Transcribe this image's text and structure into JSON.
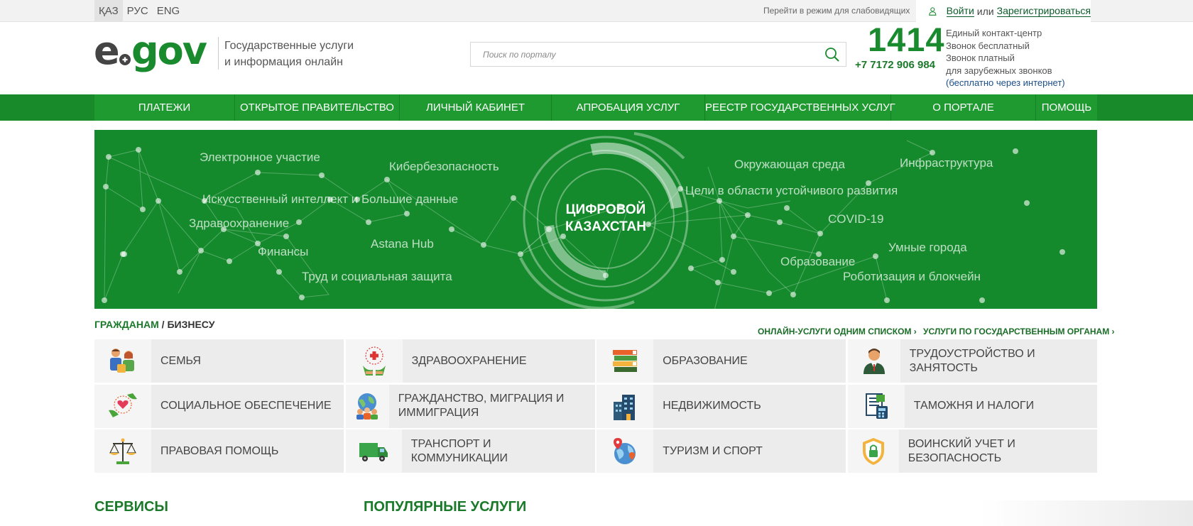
{
  "topbar": {
    "languages": [
      "ҚАЗ",
      "РУС",
      "ENG"
    ],
    "low_vision_label": "Перейти в режим для слабовидящих",
    "login_label": "Войти",
    "or_label": "или",
    "register_label": "Зарегистрироваться"
  },
  "header": {
    "tagline_line1": "Государственные услуги",
    "tagline_line2": "и информация онлайн",
    "search_placeholder": "Поиск по порталу",
    "phone_short": "1414",
    "phone_full": "+7 7172 906 984",
    "contact_lines": [
      "Единый контакт-центр",
      "Звонок бесплатный",
      "Звонок платный",
      "для зарубежных звонков"
    ],
    "contact_link": "(бесплатно через интернет)"
  },
  "nav": {
    "items": [
      "ПЛАТЕЖИ",
      "ОТКРЫТОЕ ПРАВИТЕЛЬСТВО",
      "ЛИЧНЫЙ КАБИНЕТ",
      "АПРОБАЦИЯ УСЛУГ",
      "РЕЕСТР ГОСУДАРСТВЕННЫХ УСЛУГ",
      "О ПОРТАЛЕ",
      "ПОМОЩЬ"
    ]
  },
  "banner": {
    "title_line1": "ЦИФРОВОЙ",
    "title_line2": "КАЗАХСТАН",
    "words": [
      "Электронное участие",
      "Кибербезопасность",
      "Искусственный интеллект и Большие данные",
      "Здравоохранение",
      "Финансы",
      "Astana Hub",
      "Труд и социальная защита",
      "Окружающая среда",
      "Инфраструктура",
      "Цели в области устойчивого развития",
      "COVID-19",
      "Умные города",
      "Образование",
      "Роботизация и блокчейн"
    ]
  },
  "sections": {
    "tab_citizens": "ГРАЖДАНАМ",
    "tab_sep": "/",
    "tab_business": "БИЗНЕСУ",
    "link_all_online": "ОНЛАЙН-УСЛУГИ ОДНИМ СПИСКОМ",
    "link_by_agency": "УСЛУГИ ПО ГОСУДАРСТВЕННЫМ ОРГАНАМ",
    "categories": [
      {
        "label": "СЕМЬЯ",
        "icon": "family-icon"
      },
      {
        "label": "ЗДРАВООХРАНЕНИЕ",
        "icon": "healthcare-icon"
      },
      {
        "label": "ОБРАЗОВАНИЕ",
        "icon": "books-icon"
      },
      {
        "label": "ТРУДОУСТРОЙСТВО И ЗАНЯТОСТЬ",
        "icon": "employee-icon"
      },
      {
        "label": "СОЦИАЛЬНОЕ ОБЕСПЕЧЕНИЕ",
        "icon": "heart-hands-icon"
      },
      {
        "label": "ГРАЖДАНСТВО, МИГРАЦИЯ И ИММИГРАЦИЯ",
        "icon": "globe-people-icon"
      },
      {
        "label": "НЕДВИЖИМОСТЬ",
        "icon": "building-icon"
      },
      {
        "label": "ТАМОЖНЯ И НАЛОГИ",
        "icon": "tax-document-icon"
      },
      {
        "label": "ПРАВОВАЯ ПОМОЩЬ",
        "icon": "scales-icon"
      },
      {
        "label": "ТРАНСПОРТ И КОММУНИКАЦИИ",
        "icon": "truck-icon"
      },
      {
        "label": "ТУРИЗМ И СПОРТ",
        "icon": "globe-pin-icon"
      },
      {
        "label": "ВОИНСКИЙ УЧЕТ И БЕЗОПАСНОСТЬ",
        "icon": "shield-lock-icon"
      }
    ],
    "services_title": "СЕРВИСЫ",
    "popular_title": "ПОПУЛЯРНЫЕ УСЛУГИ"
  },
  "colors": {
    "brand_green": "#1f9a30",
    "banner_green": "#148a2c",
    "link_green": "#1a7a2a"
  }
}
